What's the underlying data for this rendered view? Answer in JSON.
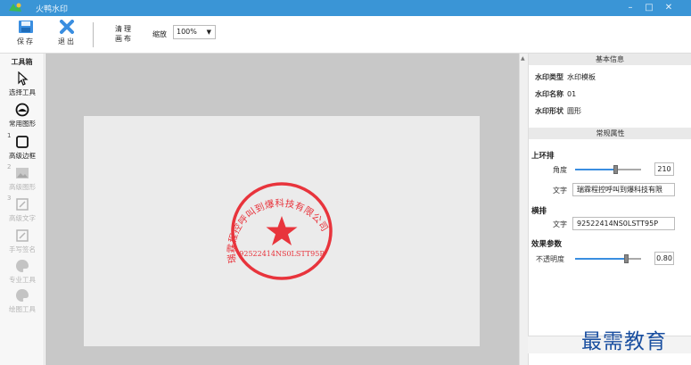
{
  "app": {
    "title": "火鸭水印"
  },
  "window_controls": {
    "minimize": "–",
    "maximize": "□",
    "close": "✕"
  },
  "toolbar": {
    "save_label": "保存",
    "exit_label": "退出",
    "clear_canvas_label": "清理画布",
    "zoom_label": "缩放",
    "zoom_value": "100%"
  },
  "toolbox": {
    "title": "工具箱",
    "tools": [
      {
        "label": "选择工具",
        "icon": "cursor-arrow-icon",
        "enabled": true
      },
      {
        "label": "常用图形",
        "icon": "seal-shape-icon",
        "enabled": true
      },
      {
        "num": "1",
        "label": "高级边框",
        "icon": "square-frame-icon",
        "enabled": true
      },
      {
        "num": "2",
        "label": "高级图形",
        "icon": "image-icon",
        "enabled": false
      },
      {
        "num": "3",
        "label": "高级文字",
        "icon": "text-edit-icon",
        "enabled": false
      },
      {
        "label": "手写签名",
        "icon": "signature-icon",
        "enabled": false
      },
      {
        "label": "专业工具",
        "icon": "palette-icon",
        "enabled": false
      },
      {
        "label": "绘图工具",
        "icon": "palette-icon",
        "enabled": false
      }
    ]
  },
  "stamp": {
    "ring_text": "瑞霖程控呼叫到爆科技有限公司",
    "horizontal_text": "92522414NS0LSTT95P",
    "color": "#e8343c"
  },
  "props": {
    "basic_info_title": "基本信息",
    "basic_info": [
      {
        "key": "水印类型",
        "value": "水印模板"
      },
      {
        "key": "水印名称",
        "value": "01"
      },
      {
        "key": "水印形状",
        "value": "圆形"
      }
    ],
    "common_props_title": "常规属性",
    "upper_ring": {
      "title": "上环排",
      "angle_label": "角度",
      "angle_value": "210",
      "angle_fraction": 0.62,
      "text_label": "文字",
      "text_value": "瑞霖程控呼叫到爆科技有限"
    },
    "horizontal": {
      "title": "横排",
      "text_label": "文字",
      "text_value": "92522414NS0LSTT95P"
    },
    "effects": {
      "title": "效果参数",
      "opacity_label": "不透明度",
      "opacity_value": "0.80",
      "opacity_fraction": 0.78
    },
    "accent": "#3a8ee0"
  },
  "watermark_text": "最需教育"
}
